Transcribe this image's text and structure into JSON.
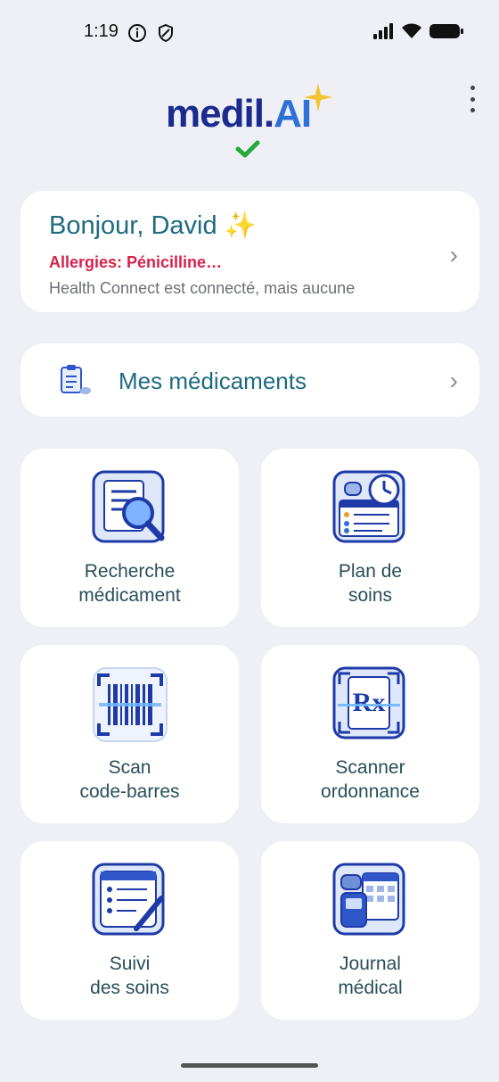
{
  "status": {
    "time": "1:19"
  },
  "logo": {
    "part1": "medil.",
    "part2": "AI"
  },
  "greeting": {
    "title": "Bonjour, David ✨",
    "allergies": "Allergies: Pénicilline…",
    "health_connect": "Health Connect est connecté, mais aucune"
  },
  "meds": {
    "label": "Mes médicaments"
  },
  "tiles": [
    {
      "line1": "Recherche",
      "line2": "médicament"
    },
    {
      "line1": "Plan de",
      "line2": "soins"
    },
    {
      "line1": "Scan",
      "line2": "code-barres"
    },
    {
      "line1": "Scanner",
      "line2": "ordonnance"
    },
    {
      "line1": "Suivi",
      "line2": "des soins"
    },
    {
      "line1": "Journal",
      "line2": "médical"
    }
  ],
  "icons": {
    "tile0": "search-medication-icon",
    "tile1": "care-plan-icon",
    "tile2": "barcode-scan-icon",
    "tile3": "prescription-scan-icon",
    "tile4": "care-tracking-icon",
    "tile5": "medical-journal-icon"
  },
  "colors": {
    "accent": "#1f6a80",
    "alert": "#d6214c",
    "brand": "#1b2a8f"
  }
}
